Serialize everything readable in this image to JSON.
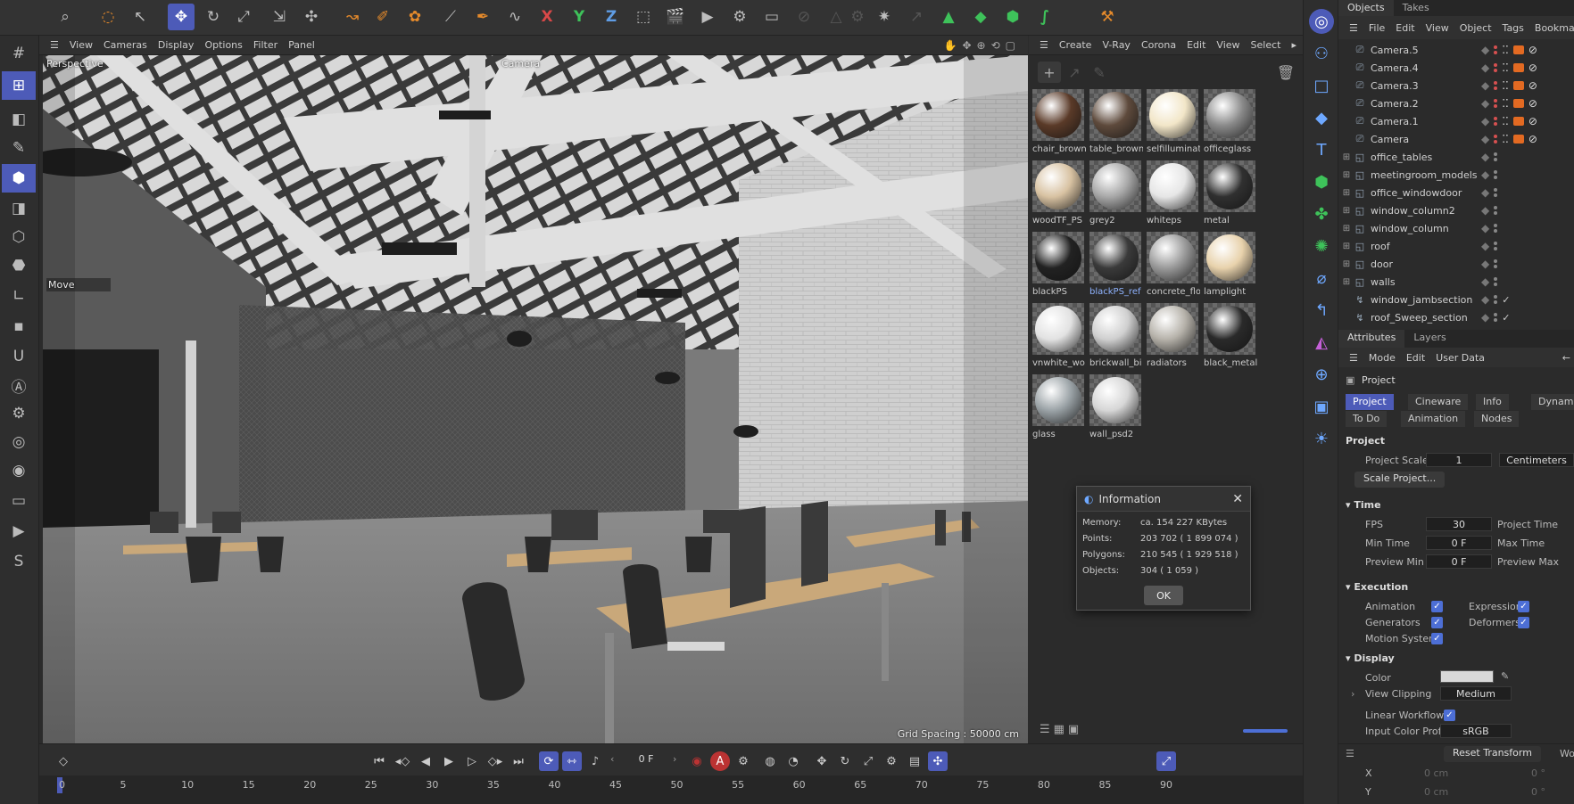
{
  "viewport_menu": [
    "View",
    "Cameras",
    "Display",
    "Options",
    "Filter",
    "Panel"
  ],
  "viewport": {
    "projection": "Perspective",
    "camera": "Camera",
    "hud_tool": "Move",
    "grid_spacing": "Grid Spacing : 50000 cm"
  },
  "material_menu": [
    "Create",
    "V-Ray",
    "Corona",
    "Edit",
    "View",
    "Select"
  ],
  "materials": [
    {
      "name": "chair_brown",
      "color": "#5a3a28"
    },
    {
      "name": "table_brown",
      "color": "#5e4a3c"
    },
    {
      "name": "selfilluminat",
      "color": "#f2e6c8"
    },
    {
      "name": "officeglass",
      "color": "#8a8a8a"
    },
    {
      "name": "woodTF_PS",
      "color": "#d8c2a2"
    },
    {
      "name": "grey2",
      "color": "#a8a8a8"
    },
    {
      "name": "whiteps",
      "color": "#e6e6e6"
    },
    {
      "name": "metal",
      "color": "#303030"
    },
    {
      "name": "blackPS",
      "color": "#222222"
    },
    {
      "name": "blackPS_ref",
      "color": "#3a3a3a"
    },
    {
      "name": "concrete_flo",
      "color": "#9a9a9a"
    },
    {
      "name": "lamplight",
      "color": "#e8d2ac"
    },
    {
      "name": "vnwhite_wo",
      "color": "#e2e2e2"
    },
    {
      "name": "brickwall_bi",
      "color": "#cfcfcf"
    },
    {
      "name": "radiators",
      "color": "#b6b2aa"
    },
    {
      "name": "black_metal",
      "color": "#2a2a2a"
    },
    {
      "name": "glass",
      "color": "#9aa2a6"
    },
    {
      "name": "wall_psd2",
      "color": "#d6d6d6"
    }
  ],
  "objects_tabs": [
    "Objects",
    "Takes"
  ],
  "objects_menu": [
    "File",
    "Edit",
    "View",
    "Object",
    "Tags",
    "Bookmarks"
  ],
  "objects": [
    {
      "name": "Camera.5",
      "type": "camera"
    },
    {
      "name": "Camera.4",
      "type": "camera"
    },
    {
      "name": "Camera.3",
      "type": "camera"
    },
    {
      "name": "Camera.2",
      "type": "camera"
    },
    {
      "name": "Camera.1",
      "type": "camera"
    },
    {
      "name": "Camera",
      "type": "camera"
    },
    {
      "name": "office_tables",
      "type": "null"
    },
    {
      "name": "meetingroom_models",
      "type": "null"
    },
    {
      "name": "office_windowdoor",
      "type": "null"
    },
    {
      "name": "window_column2",
      "type": "null"
    },
    {
      "name": "window_column",
      "type": "null"
    },
    {
      "name": "roof",
      "type": "null"
    },
    {
      "name": "door",
      "type": "null"
    },
    {
      "name": "walls",
      "type": "null"
    },
    {
      "name": "window_jambsection",
      "type": "sweep"
    },
    {
      "name": "roof_Sweep_section",
      "type": "sweep"
    }
  ],
  "attributes": {
    "tabs": [
      "Attributes",
      "Layers"
    ],
    "menu": [
      "Mode",
      "Edit",
      "User Data"
    ],
    "object_label": "Project",
    "tab_row1": [
      "Project",
      "Cineware",
      "Info",
      "Dynam"
    ],
    "tab_row2": [
      "To Do",
      "Animation",
      "Nodes"
    ],
    "section_project": "Project",
    "project_scale_label": "Project Scale",
    "project_scale_value": "1",
    "project_scale_unit": "Centimeters",
    "scale_project_button": "Scale Project...",
    "section_time": "Time",
    "fps_label": "FPS",
    "fps_value": "30",
    "project_time_label": "Project Time",
    "min_time_label": "Min Time",
    "min_time_value": "0 F",
    "max_time_label": "Max Time",
    "preview_min_label": "Preview Min",
    "preview_min_value": "0 F",
    "preview_max_label": "Preview Max",
    "section_execution": "Execution",
    "animation_label": "Animation",
    "expression_label": "Expression",
    "generators_label": "Generators",
    "deformers_label": "Deformers",
    "motion_system_label": "Motion System",
    "section_display": "Display",
    "color_label": "Color",
    "color_value": "#d8d8d8",
    "view_clipping_label": "View Clipping",
    "view_clipping_value": "Medium",
    "linear_workflow_label": "Linear Workflow",
    "input_color_profile_label": "Input Color Profile",
    "input_color_profile_value": "sRGB"
  },
  "coordinates": {
    "reset_transform": "Reset Transform",
    "world": "Wo",
    "x_label": "X",
    "x_value": "0 cm",
    "x_rot": "0 °",
    "y_label": "Y",
    "y_value": "0 cm",
    "y_rot": "0 °"
  },
  "animation": {
    "current_frame": "0 F",
    "timeline_ticks": [
      "0",
      "5",
      "10",
      "15",
      "20",
      "25",
      "30",
      "35",
      "40",
      "45",
      "50",
      "55",
      "60",
      "65",
      "70",
      "75",
      "80",
      "85",
      "90"
    ]
  },
  "info_dialog": {
    "title": "Information",
    "rows": [
      {
        "label": "Memory:",
        "value": "ca. 154 227 KBytes"
      },
      {
        "label": "Points:",
        "value": "203 702 ( 1 899 074 )"
      },
      {
        "label": "Polygons:",
        "value": "210 545 ( 1 929 518 )"
      },
      {
        "label": "Objects:",
        "value": "304 ( 1 059 )"
      }
    ],
    "ok_label": "OK"
  },
  "colors": {
    "accent": "#4d5bb8",
    "panel_bg": "#2b2b2b",
    "check_blue": "#4d6fd6"
  }
}
